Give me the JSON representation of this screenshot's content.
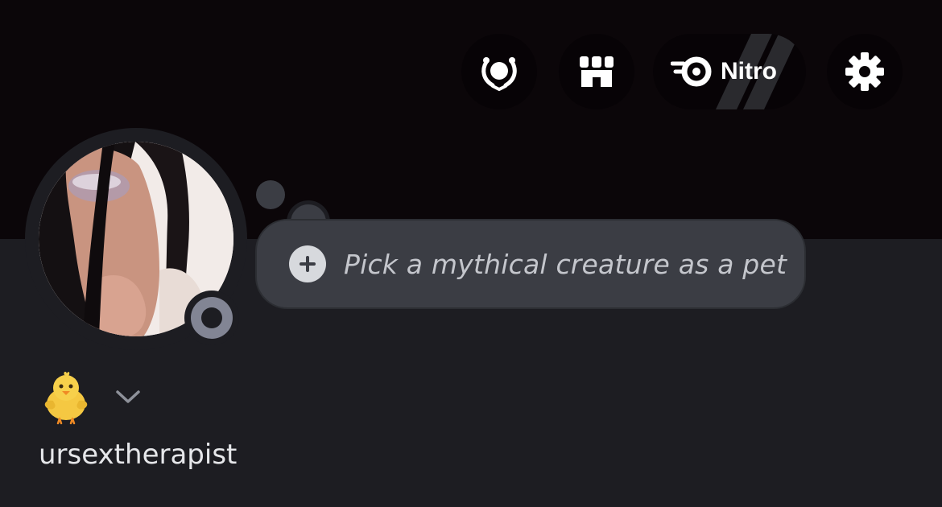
{
  "header": {
    "buttons": [
      {
        "id": "orbs",
        "icon": "laurel-orb-icon"
      },
      {
        "id": "shop",
        "icon": "shop-icon"
      },
      {
        "id": "nitro",
        "icon": "nitro-icon",
        "label": "Nitro"
      },
      {
        "id": "settings",
        "icon": "gear-icon"
      }
    ]
  },
  "profile": {
    "avatar": "profile-photo",
    "status": "offline",
    "status_color": "#828594",
    "custom_status_placeholder": "Pick a mythical creature as a pet",
    "emoji": "🐥",
    "username": "ursextherapist"
  },
  "colors": {
    "banner": "#0b0609",
    "background": "#1d1d22",
    "bubble": "#3b3d44"
  }
}
